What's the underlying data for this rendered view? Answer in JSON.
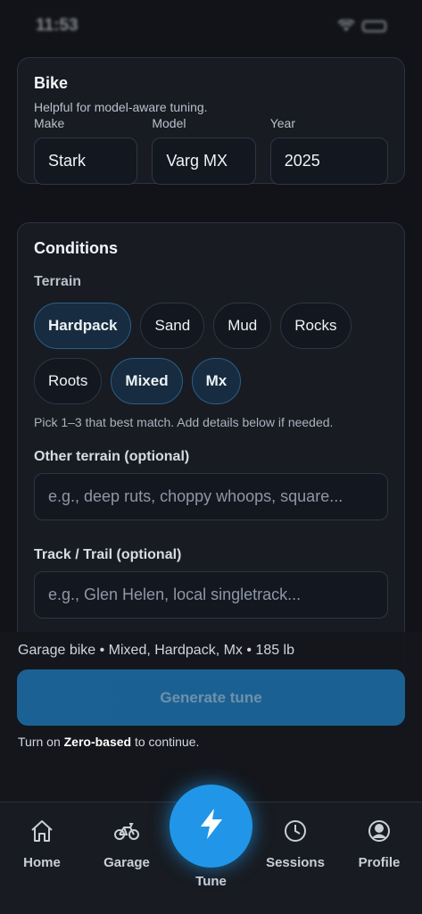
{
  "status": {
    "time": "11:53"
  },
  "bike": {
    "title": "Bike",
    "subtitle": "Helpful for model-aware tuning.",
    "fields": [
      {
        "label": "Make",
        "value": "Stark"
      },
      {
        "label": "Model",
        "value": "Varg MX"
      },
      {
        "label": "Year",
        "value": "2025"
      }
    ]
  },
  "conditions": {
    "title": "Conditions",
    "terrain_label": "Terrain",
    "terrain_chips": [
      {
        "label": "Hardpack",
        "selected": true
      },
      {
        "label": "Sand",
        "selected": false
      },
      {
        "label": "Mud",
        "selected": false
      },
      {
        "label": "Rocks",
        "selected": false
      },
      {
        "label": "Roots",
        "selected": false
      },
      {
        "label": "Mixed",
        "selected": true
      },
      {
        "label": "Mx",
        "selected": true
      }
    ],
    "hint": "Pick 1–3 that best match. Add details below if needed.",
    "other_terrain_label": "Other terrain (optional)",
    "other_terrain_placeholder": "e.g., deep ruts, choppy whoops, square...",
    "track_label": "Track / Trail (optional)",
    "track_placeholder": "e.g., Glen Helen, local singletrack..."
  },
  "sheet": {
    "summary": "Garage bike • Mixed, Hardpack, Mx • 185 lb",
    "generate_label": "Generate tune",
    "notice_prefix": "Turn on ",
    "notice_bold": "Zero-based",
    "notice_suffix": " to continue."
  },
  "tabs": {
    "home": "Home",
    "garage": "Garage",
    "tune": "Tune",
    "sessions": "Sessions",
    "profile": "Profile"
  },
  "colors": {
    "accent": "#2196e8",
    "button": "#1d6ea8",
    "background": "#111318"
  }
}
